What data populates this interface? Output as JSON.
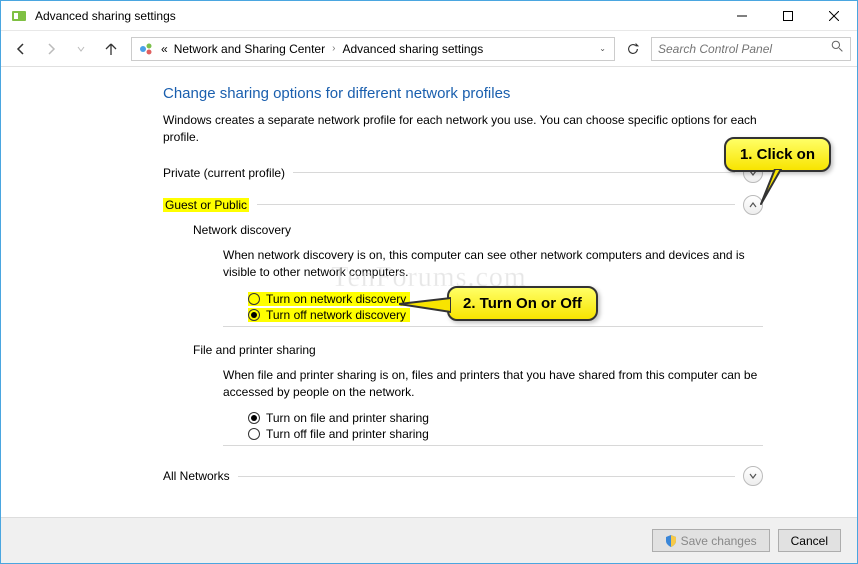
{
  "window": {
    "title": "Advanced sharing settings"
  },
  "nav": {
    "crumb_ellipsis": "«",
    "crumb1": "Network and Sharing Center",
    "crumb2": "Advanced sharing settings",
    "search_placeholder": "Search Control Panel"
  },
  "page": {
    "title": "Change sharing options for different network profiles",
    "desc": "Windows creates a separate network profile for each network you use. You can choose specific options for each profile."
  },
  "profiles": {
    "private": {
      "label": "Private (current profile)"
    },
    "guest": {
      "label": "Guest or Public",
      "network_discovery": {
        "title": "Network discovery",
        "desc": "When network discovery is on, this computer can see other network computers and devices and is visible to other network computers.",
        "on": "Turn on network discovery",
        "off": "Turn off network discovery"
      },
      "file_printer": {
        "title": "File and printer sharing",
        "desc": "When file and printer sharing is on, files and printers that you have shared from this computer can be accessed by people on the network.",
        "on": "Turn on file and printer sharing",
        "off": "Turn off file and printer sharing"
      }
    },
    "all": {
      "label": "All Networks"
    }
  },
  "footer": {
    "save": "Save changes",
    "cancel": "Cancel"
  },
  "annotations": {
    "a1": "1. Click on",
    "a2": "2. Turn On or Off"
  },
  "watermark": "TenForums.com"
}
